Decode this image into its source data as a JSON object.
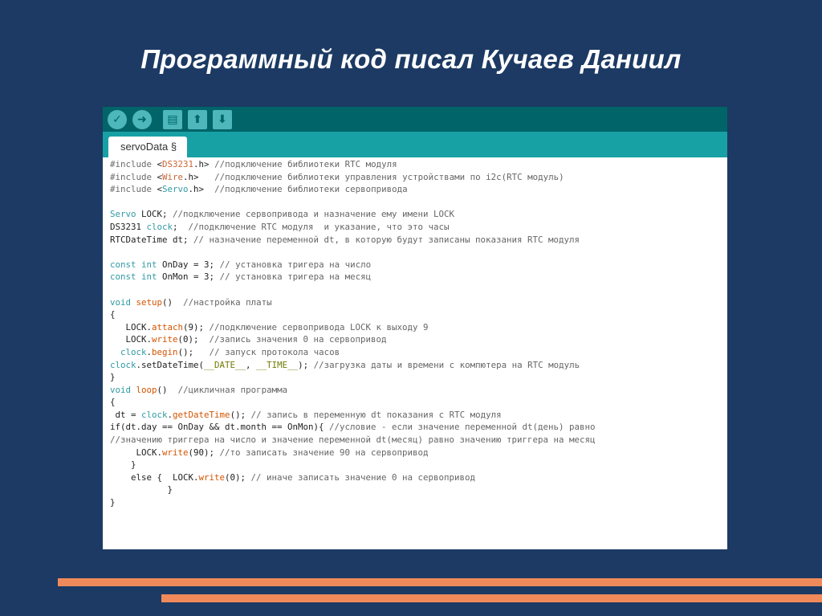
{
  "slide": {
    "title": "Программный код писал Кучаев Даниил"
  },
  "ide": {
    "toolbar": {
      "buttons": [
        {
          "name": "verify",
          "icon": "check-icon",
          "glyph": "✓"
        },
        {
          "name": "upload",
          "icon": "arrow-right-icon",
          "glyph": "➜"
        },
        {
          "name": "new",
          "icon": "new-file-icon",
          "glyph": "▤"
        },
        {
          "name": "open",
          "icon": "arrow-up-icon",
          "glyph": "⬆"
        },
        {
          "name": "save",
          "icon": "arrow-down-icon",
          "glyph": "⬇"
        }
      ]
    },
    "tab_label": "servoData §",
    "code_lines": [
      "#include <DS3231.h> //подключение библиотеки RTC модуля",
      "#include <Wire.h>   //подключение библиотеки управления устройствами по i2c(RTC модуль)",
      "#include <Servo.h>  //подключение библиотеки сервопривода",
      "",
      "Servo LOCK; //подключение сервопривода и назначение ему имени LOCK",
      "DS3231 clock;  //подключение RTC модуля  и указание, что это часы",
      "RTCDateTime dt; // назначение переменной dt, в которую будут записаны показания RTC модуля",
      "",
      "const int OnDay = 3; // установка тригера на число",
      "const int OnMon = 3; // установка тригера на месяц",
      "",
      "void setup()  //настройка платы",
      "{",
      "   LOCK.attach(9); //подключение сервопривода LOCK к выходу 9",
      "   LOCK.write(0);  //запись значения 0 на сервопривод",
      "  clock.begin();   // запуск протокола часов",
      "clock.setDateTime(__DATE__, __TIME__); //загрузка даты и времени с компютера на RTC модуль",
      "}",
      "void loop()  //цикличная программа",
      "{",
      " dt = clock.getDateTime(); // запись в переменную dt показания с RTC модуля",
      "if(dt.day == OnDay && dt.month == OnMon){ //условие - если значение переменной dt(день) равно",
      "//значению триггера на число и значение переменной dt(месяц) равно значению триггера на месяц",
      "     LOCK.write(90); //то записать значение 90 на сервопривод",
      "    }",
      "    else {  LOCK.write(0); // иначе записать значение 0 на сервопривод",
      "           }",
      "}"
    ]
  },
  "colors": {
    "background": "#1c3a63",
    "toolbar": "#006468",
    "tabbar": "#17a1a5",
    "button": "#4db7bb",
    "accent_bars": "#f08a5a",
    "code_keyword": "#2f9aa3",
    "code_function": "#d35400",
    "code_library": "#cc6633"
  }
}
